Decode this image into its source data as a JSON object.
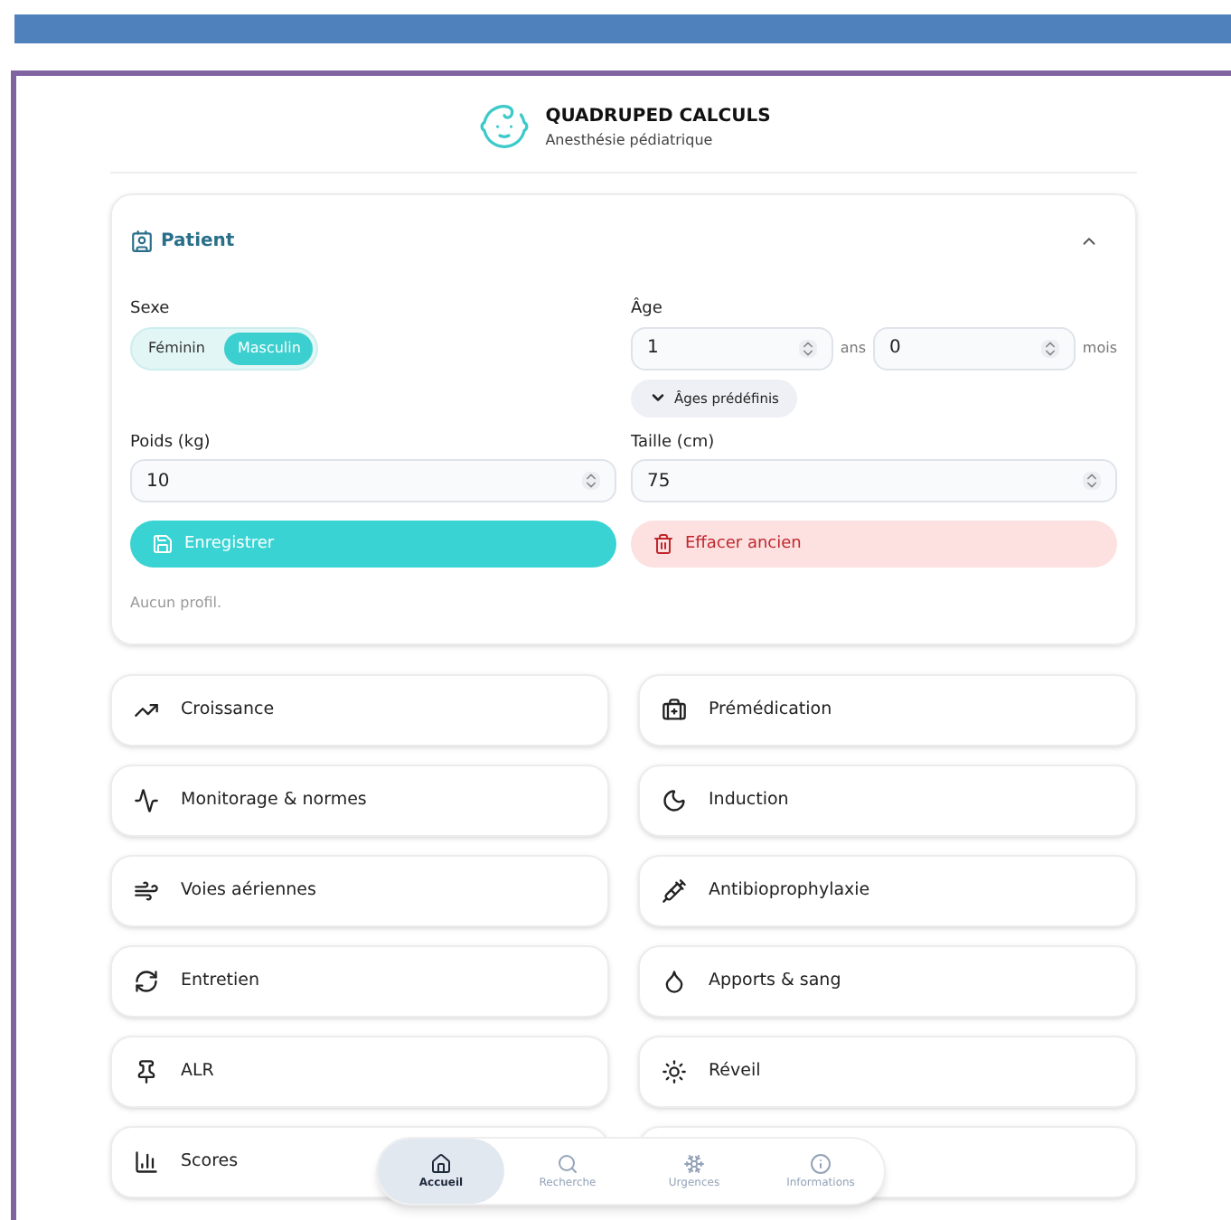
{
  "header": {
    "title": "QUADRUPED CALCULS",
    "subtitle": "Anesthésie pédiatrique"
  },
  "patient": {
    "title": "Patient",
    "expanded": true,
    "sex": {
      "label": "Sexe",
      "options": [
        {
          "label": "Féminin",
          "selected": false
        },
        {
          "label": "Masculin",
          "selected": true
        }
      ]
    },
    "age": {
      "label": "Âge",
      "years": "1",
      "years_unit": "ans",
      "months": "0",
      "months_unit": "mois",
      "presets": "Âges prédéfinis"
    },
    "weight": {
      "label": "Poids (kg)",
      "value": "10"
    },
    "height": {
      "label": "Taille (cm)",
      "value": "75"
    },
    "save": "Enregistrer",
    "clear": "Effacer ancien",
    "status": "Aucun profil."
  },
  "sections": [
    {
      "kind": "link",
      "label": "Croissance"
    },
    {
      "kind": "link",
      "label": "Prémédication"
    },
    {
      "kind": "link",
      "label": "Monitorage & normes"
    },
    {
      "kind": "link",
      "label": "Induction"
    },
    {
      "kind": "link",
      "label": "Voies aériennes"
    },
    {
      "kind": "link",
      "label": "Antibioprophylaxie"
    },
    {
      "kind": "link",
      "label": "Entretien"
    },
    {
      "kind": "link",
      "label": "Apports & sang"
    },
    {
      "kind": "link",
      "label": "ALR"
    },
    {
      "kind": "link",
      "label": "Réveil"
    },
    {
      "kind": "link",
      "label": "Scores"
    },
    {
      "kind": "blank"
    }
  ],
  "nav": [
    {
      "label": "Accueil",
      "selected": true
    },
    {
      "label": "Recherche",
      "selected": false
    },
    {
      "label": "Urgences",
      "selected": false
    },
    {
      "label": "Informations",
      "selected": false
    }
  ]
}
